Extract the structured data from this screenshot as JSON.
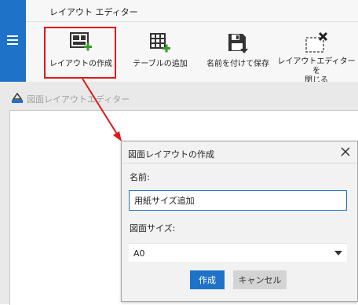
{
  "ribbon": {
    "title": "レイアウト エディター",
    "buttons": [
      {
        "label": "レイアウトの作成",
        "icon": "create-layout-icon"
      },
      {
        "label": "テーブルの追加",
        "icon": "add-table-icon"
      },
      {
        "label": "名前を付けて保存",
        "icon": "save-as-icon"
      },
      {
        "label": "レイアウトエディターを閉じる",
        "label_line1": "レイアウトエディターを",
        "label_line2": "閉じる",
        "icon": "close-editor-icon"
      }
    ]
  },
  "editor": {
    "title": "図面レイアウトエディター"
  },
  "dialog": {
    "title": "図面レイアウトの作成",
    "name_label": "名前:",
    "name_value": "用紙サイズ追加",
    "size_label": "図面サイズ:",
    "size_value": "A0",
    "create_label": "作成",
    "cancel_label": "キャンセル"
  },
  "colors": {
    "accent": "#1e73c8",
    "highlight": "#e01818",
    "plus": "#3a9a2a"
  }
}
